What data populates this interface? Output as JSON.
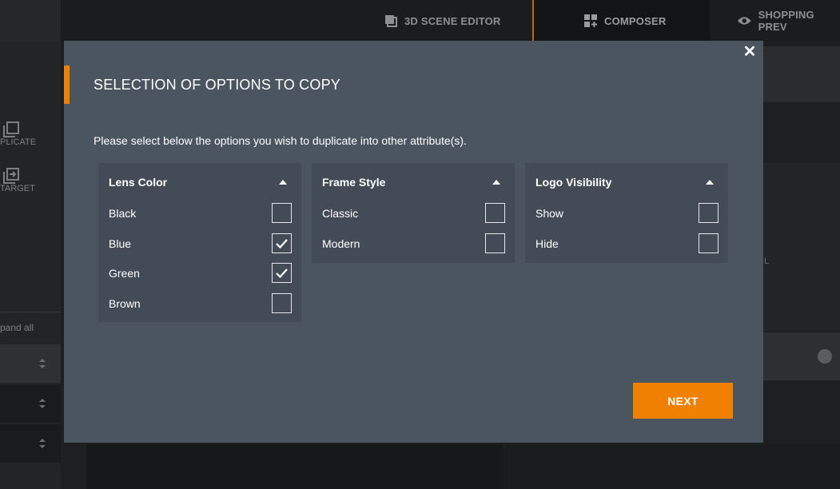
{
  "topbar": {
    "tabs": [
      {
        "label": "3D SCENE EDITOR",
        "icon": "layers-icon"
      },
      {
        "label": "COMPOSER",
        "icon": "composer-icon"
      },
      {
        "label": "SHOPPING PREV",
        "icon": "eye-icon"
      }
    ]
  },
  "sidebar": {
    "items": [
      {
        "label": "PLICATE",
        "icon": "duplicate-icon"
      },
      {
        "label": "TARGET",
        "icon": "target-copy-icon"
      }
    ],
    "expand_label": "pand all"
  },
  "right_panel": {
    "partial_label": "L"
  },
  "modal": {
    "title": "SELECTION OF OPTIONS TO COPY",
    "description": "Please select below the options you wish to duplicate into other attribute(s).",
    "close_icon": "close-icon",
    "accent_color": "#f08000",
    "groups": [
      {
        "name": "Lens Color",
        "options": [
          {
            "label": "Black",
            "checked": false
          },
          {
            "label": "Blue",
            "checked": true
          },
          {
            "label": "Green",
            "checked": true
          },
          {
            "label": "Brown",
            "checked": false
          }
        ]
      },
      {
        "name": "Frame Style",
        "options": [
          {
            "label": "Classic",
            "checked": false
          },
          {
            "label": "Modern",
            "checked": false
          }
        ]
      },
      {
        "name": "Logo Visibility",
        "options": [
          {
            "label": "Show",
            "checked": false
          },
          {
            "label": "Hide",
            "checked": false
          }
        ]
      }
    ],
    "next_label": "NEXT"
  }
}
